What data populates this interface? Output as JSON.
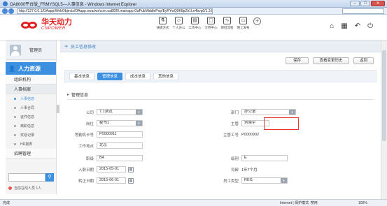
{
  "browser": {
    "title": "OA8000平台版_FRMYSQL5—人事信息 - Windows Internet Explorer",
    "url": "http://127.0.0.1/OAapp/WebObjects/OAapp.woa/wo/com.oa8000.mainapp.OaPubMiddlePop/EyRYwQ9K8pZh1Le4bvg0/1.3.0#",
    "status_left": "完成",
    "status_zone": "Internet | 保护模式: 禁用",
    "zoom": "100%"
  },
  "header": {
    "logo_cn": "华天动力",
    "logo_en": "CNPOWER",
    "tools": [
      {
        "icon": "⚗",
        "label": "快捷方式"
      },
      {
        "icon": "☺",
        "label": "个人办公"
      },
      {
        "icon": "▤",
        "label": "工作中心"
      },
      {
        "icon": "▢",
        "label": "文档中心"
      },
      {
        "icon": "∿",
        "label": "审批流程"
      },
      {
        "icon": "▭",
        "label": "网上发布"
      }
    ],
    "add_icon": "+",
    "right_icons": [
      "⌂",
      "▦",
      "↶",
      "⏻"
    ]
  },
  "sidebar": {
    "username": "管理员",
    "module": "人力资源",
    "groups": [
      "组织机构",
      "人事档案"
    ],
    "items": [
      "人事信息",
      "人事合同",
      "证件信息",
      "离职信息",
      "奖惩记录",
      "HR报表"
    ],
    "bottom_group": "招聘管理",
    "online": "当前在线人员 1人"
  },
  "page": {
    "title": "员工信息修改",
    "buttons": {
      "save": "保存",
      "history": "查看变更历史",
      "back": "返回"
    },
    "tabs": [
      "基本信息",
      "管理信息",
      "成本信息",
      "其他信息"
    ],
    "section": "管理信息",
    "fields": {
      "company": {
        "label": "公司",
        "value": "7.1测试"
      },
      "dept": {
        "label": "部门",
        "value": "办公室"
      },
      "position": {
        "label": "岗位",
        "value": "秘书1"
      },
      "manager": {
        "label": "主管",
        "value": "刘晓宇"
      },
      "attendance": {
        "label": "考勤机卡号",
        "value": "P0000911"
      },
      "manager_no": {
        "label": "主管工号",
        "value": "P0000902"
      },
      "work_place": {
        "label": "工作地点",
        "value": "北京"
      },
      "rank": {
        "label": "职级",
        "value": "B4"
      },
      "level": {
        "label": "级别",
        "value": "E"
      },
      "join_date": {
        "label": "入职日期",
        "value": "2015-05-01"
      },
      "seniority": {
        "label": "司龄",
        "value": "1年7个月"
      },
      "reg_date": {
        "label": "转正日期",
        "value": "2015-06-01"
      },
      "emp_type": {
        "label": "员工类型",
        "value": "REG"
      }
    }
  }
}
